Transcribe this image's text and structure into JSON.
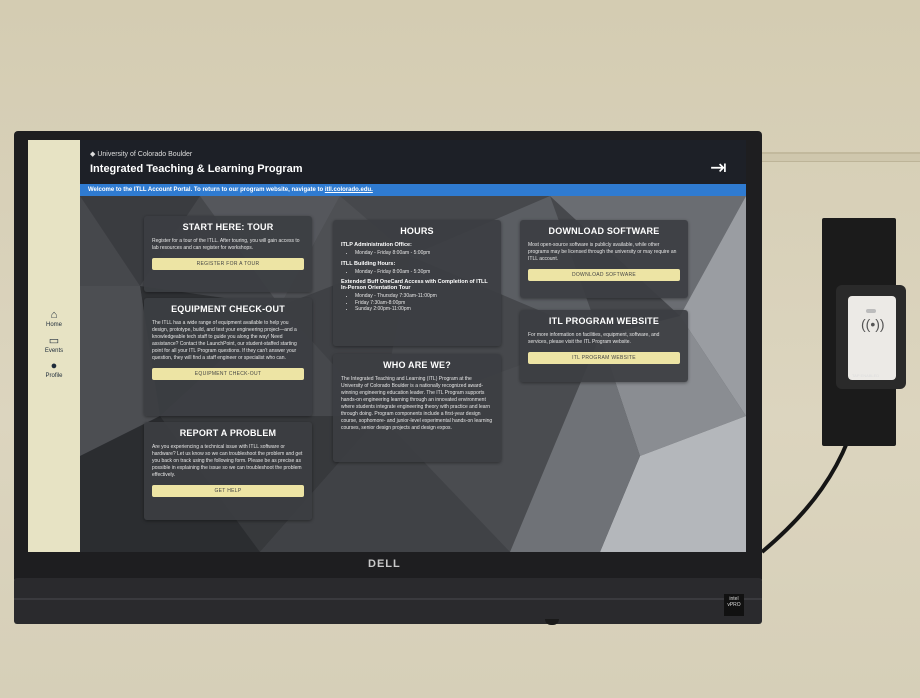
{
  "header": {
    "university": "University of Colorado Boulder",
    "title": "Integrated Teaching & Learning Program"
  },
  "banner": {
    "text": "Welcome to the ITLL Account Portal. To return to our program website, navigate to ",
    "link": "itll.colorado.edu."
  },
  "sidebar": {
    "items": [
      {
        "label": "Home",
        "icon": "home-icon"
      },
      {
        "label": "Events",
        "icon": "events-icon"
      },
      {
        "label": "Profile",
        "icon": "profile-icon"
      }
    ]
  },
  "cards": {
    "tour": {
      "title": "START HERE: TOUR",
      "body": "Register for a tour of the ITLL. After touring, you will gain access to lab resources and can register for workshops.",
      "button": "REGISTER FOR A TOUR"
    },
    "equipment": {
      "title": "EQUIPMENT CHECK-OUT",
      "body": "The ITLL has a wide range of equipment available to help you design, prototype, build, and test your engineering project—and a knowledgeable tech staff to guide you along the way! Need assistance? Contact the LaunchPoint, our student-staffed starting point for all your ITL Program questions. If they can't answer your question, they will find a staff engineer or specialist who can.",
      "button": "EQUIPMENT CHECK-OUT"
    },
    "problem": {
      "title": "REPORT A PROBLEM",
      "body": "Are you experiencing a technical issue with ITLL software or hardware? Let us know so we can troubleshoot the problem and get you back on track using the following form. Please be as precise as possible in explaining the issue so we can troubleshoot the problem effectively.",
      "button": "GET HELP"
    },
    "hours": {
      "title": "HOURS",
      "section1": "ITLP Administration Office:",
      "section1_items": [
        "Monday - Friday 8:00am - 5:00pm"
      ],
      "section2": "ITLL Building Hours:",
      "section2_items": [
        "Monday - Friday 8:00am - 5:30pm"
      ],
      "section3": "Extended Buff OneCard Access with Completion of ITLL In-Person Orientation Tour",
      "section3_items": [
        "Monday - Thursday 7:30am-11:00pm",
        "Friday 7:30am-8:00pm",
        "Sunday 2:00pm-11:00pm"
      ]
    },
    "who": {
      "title": "WHO ARE WE?",
      "body": "The Integrated Teaching and Learning (ITL) Program at the University of Colorado Boulder is a nationally recognized award-winning engineering education leader. The ITL Program supports hands-on engineering learning through an innovated environment where students integrate engineering theory with practice and learn through doing. Program components include a first-year design course, sophomore- and junior-level experimental hands-on learning courses, senior design projects and design expos."
    },
    "download": {
      "title": "DOWNLOAD SOFTWARE",
      "body": "Most open-source software is publicly available, while other programs may be licensed through the university or may require an ITLL account.",
      "button": "DOWNLOAD SOFTWARE"
    },
    "website": {
      "title": "ITL PROGRAM WEBSITE",
      "body": "For more information on facilities, equipment, software, and services, please visit the ITL Program website.",
      "button": "ITL PROGRAM WEBSITE"
    }
  },
  "hardware": {
    "brand": "DELL",
    "badge_top": "intel",
    "badge": "vPRO",
    "reader_label": "TAP ENABLED"
  },
  "colors": {
    "banner": "#2f7bd1",
    "button": "#ede4a4",
    "sidebar": "#e7e3c4",
    "header": "#1d2027"
  }
}
